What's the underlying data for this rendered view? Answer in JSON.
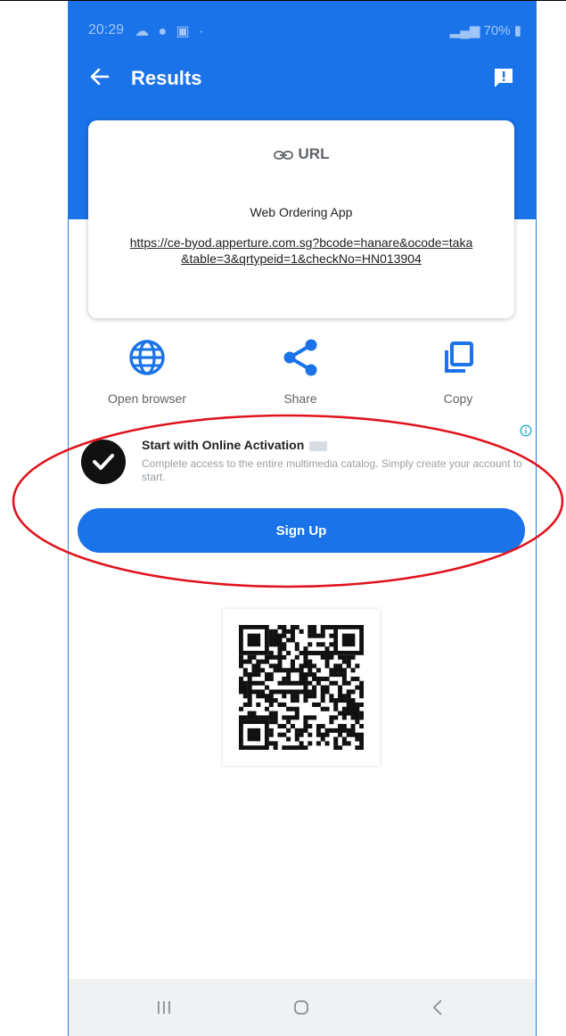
{
  "status_bar": {
    "time": "20:29",
    "left_icons": "☁ ● ▣ ·",
    "battery": "70%"
  },
  "appbar": {
    "title": "Results",
    "back_icon": "arrow-left-icon",
    "feedback_icon": "feedback-icon"
  },
  "url_card": {
    "heading": "URL",
    "app_name": "Web Ordering App",
    "link": "https://ce-byod.apperture.com.sg?bcode=hanare&ocode=taka&table=3&qrtypeid=1&checkNo=HN013904"
  },
  "actions": [
    {
      "label": "Open browser",
      "icon": "globe-icon"
    },
    {
      "label": "Share",
      "icon": "share-icon"
    },
    {
      "label": "Copy",
      "icon": "copy-icon"
    }
  ],
  "promo": {
    "title": "Start with Online Activation",
    "description": "Complete access to the entire multimedia catalog. Simply create your account to start.",
    "button": "Sign Up"
  },
  "colors": {
    "primary": "#1a73e8",
    "annotation": "#e0141e"
  }
}
